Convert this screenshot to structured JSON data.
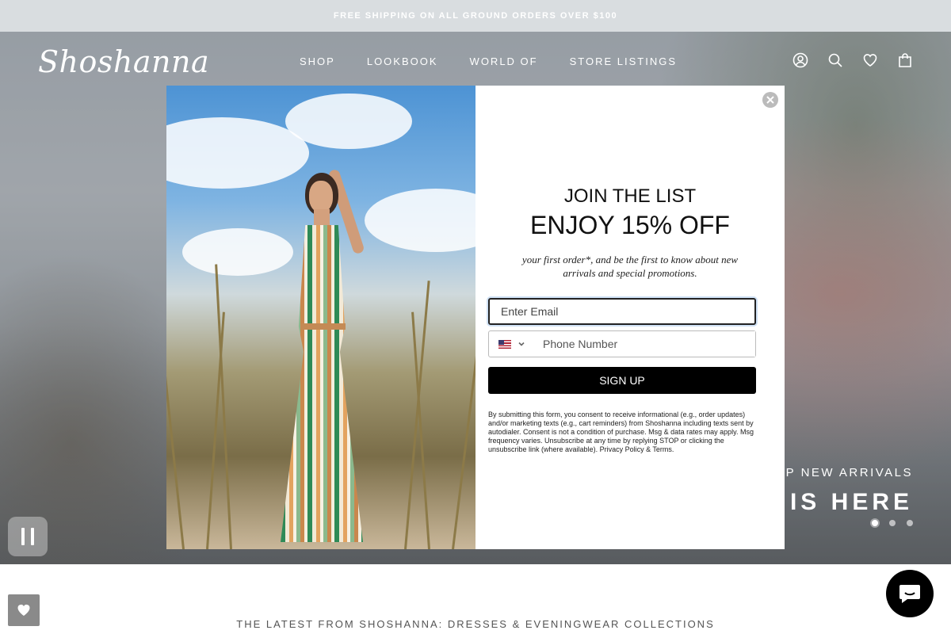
{
  "announcement": "FREE SHIPPING ON ALL GROUND ORDERS OVER $100",
  "header": {
    "logo": "Shoshanna",
    "nav": [
      "SHOP",
      "LOOKBOOK",
      "WORLD OF",
      "STORE LISTINGS"
    ],
    "icons": [
      "account-icon",
      "search-icon",
      "wishlist-icon",
      "cart-icon"
    ]
  },
  "hero": {
    "subtitle": "OP NEW ARRIVALS",
    "headline": "IS HERE",
    "slides_count": 3,
    "active_slide": 1
  },
  "popup": {
    "title": "JOIN THE LIST",
    "offer": "ENJOY 15% OFF",
    "description": "your first order*, and be the first to know about new arrivals and special promotions.",
    "email_placeholder": "Enter Email",
    "phone_placeholder": "Phone Number",
    "signup_label": "SIGN UP",
    "legal": "By submitting this form, you consent to receive informational (e.g., order updates) and/or marketing texts (e.g., cart reminders) from Shoshanna including texts sent by autodialer. Consent is not a condition of purchase. Msg & data rates may apply. Msg frequency varies. Unsubscribe at any time by replying STOP or clicking the unsubscribe link (where available). Privacy Policy & Terms."
  },
  "latest": "THE LATEST FROM SHOSHANNA: DRESSES & EVENINGWEAR COLLECTIONS",
  "colors": {
    "announcement_bg": "#d9dde0",
    "signup_bg": "#000000",
    "chat_bg": "#000000"
  }
}
